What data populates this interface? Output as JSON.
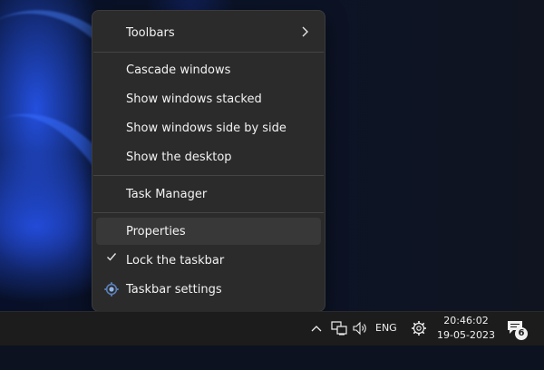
{
  "menu": {
    "toolbars": "Toolbars",
    "cascade": "Cascade windows",
    "stacked": "Show windows stacked",
    "side_by_side": "Show windows side by side",
    "show_desktop": "Show the desktop",
    "task_manager": "Task Manager",
    "properties": "Properties",
    "lock_taskbar": "Lock the taskbar",
    "taskbar_settings": "Taskbar settings",
    "chevron_icon": "chevron-right-icon",
    "check_icon": "checkmark-icon",
    "settings_icon": "gear-icon"
  },
  "taskbar": {
    "language": "ENG",
    "time": "20:46:02",
    "date": "19-05-2023",
    "notification_count": "6",
    "icons": [
      "chevron-up-icon",
      "network-icon",
      "volume-icon",
      "gear-icon",
      "notification-icon"
    ]
  },
  "colors": {
    "menu_bg": "#2b2b2b",
    "hover_bg": "#383838",
    "taskbar_bg": "#1c1c1c",
    "text": "#f2f2f2"
  }
}
